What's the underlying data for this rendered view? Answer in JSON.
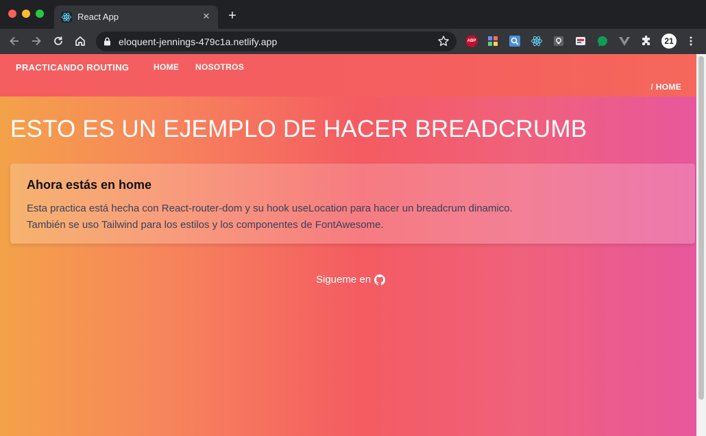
{
  "browser": {
    "tab_title": "React App",
    "url": "eloquent-jennings-479c1a.netlify.app",
    "extensions": [
      {
        "name": "adblock-plus-icon",
        "label": "ABP"
      },
      {
        "name": "extension-2-icon"
      },
      {
        "name": "search-extension-icon"
      },
      {
        "name": "react-devtools-icon"
      },
      {
        "name": "lightbulb-extension-icon"
      },
      {
        "name": "extension-6-icon"
      },
      {
        "name": "green-extension-icon"
      },
      {
        "name": "vue-devtools-icon"
      },
      {
        "name": "puzzle-icon"
      },
      {
        "name": "profile-badge",
        "label": "21"
      }
    ]
  },
  "navbar": {
    "brand": "PRACTICANDO ROUTING",
    "links": [
      "HOME",
      "NOSOTROS"
    ],
    "breadcrumb": "/ HOME"
  },
  "main": {
    "heading": "ESTO ES UN EJEMPLO DE HACER BREADCRUMB",
    "card": {
      "title": "Ahora estás en home",
      "line1": "Esta practica está hecha con React-router-dom y su hook useLocation para hacer un breadcrum dinamico.",
      "line2": "También se uso Tailwind para los estilos y los componentes de FontAwesome."
    },
    "footer_text": "Sigueme en"
  },
  "colors": {
    "gradient_left": "#f4a24a",
    "gradient_mid": "#f45b62",
    "gradient_right": "#e8579c",
    "navbar": "#f55d60"
  }
}
